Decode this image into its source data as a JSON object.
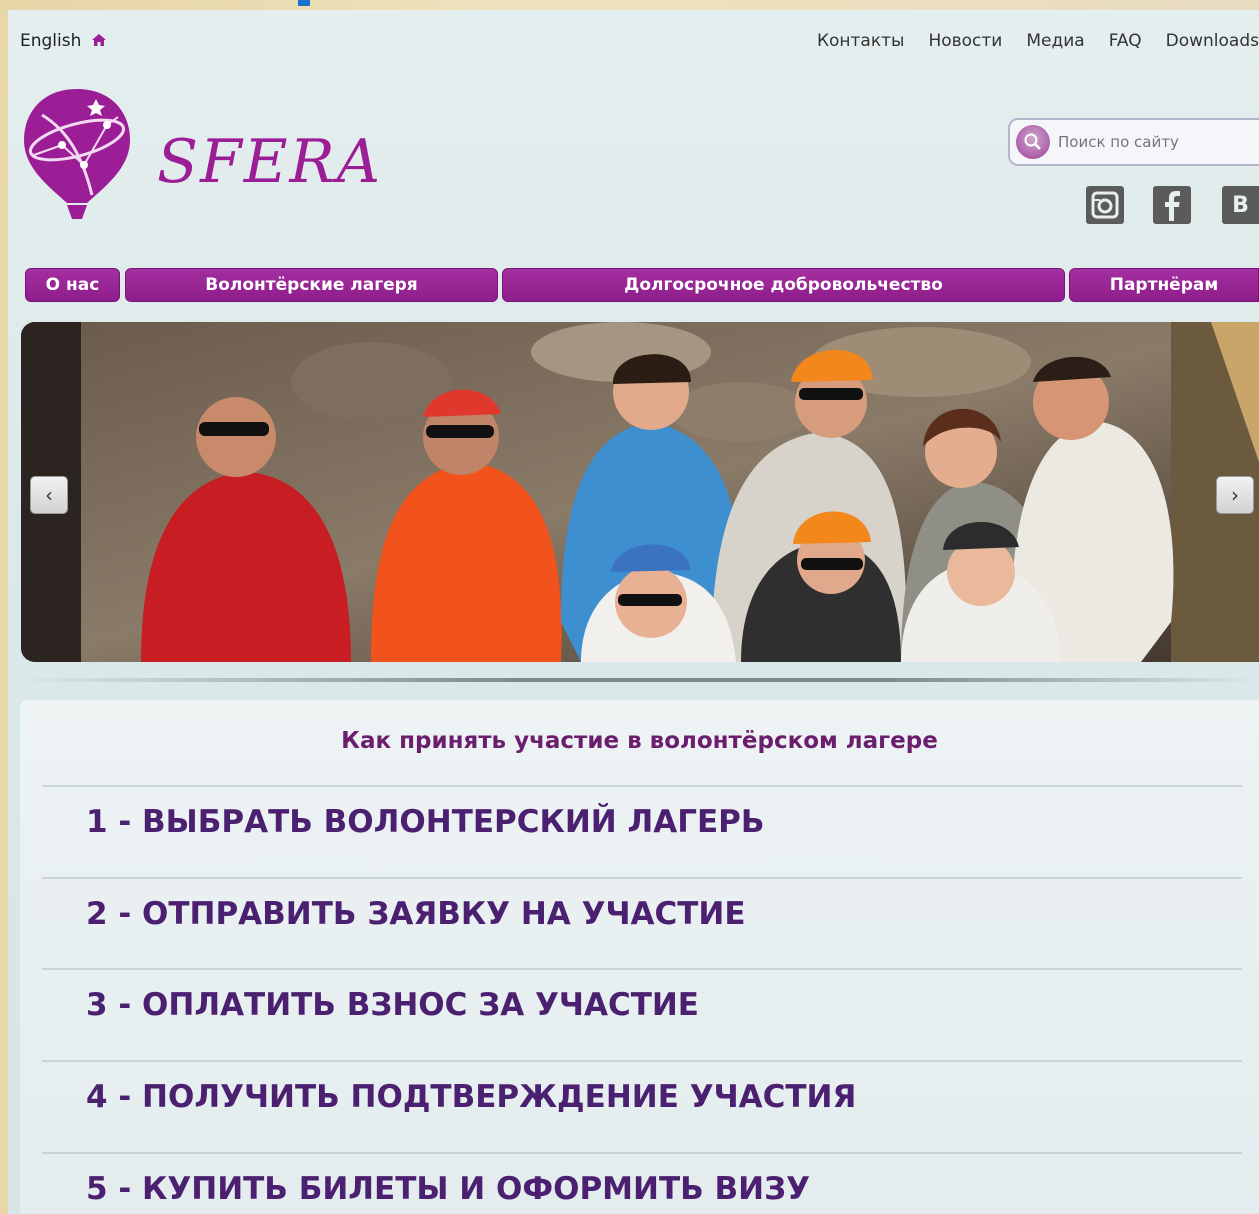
{
  "top": {
    "language": "English",
    "nav": [
      "Контакты",
      "Новости",
      "Медиа",
      "FAQ",
      "Downloads"
    ]
  },
  "logo": {
    "text": "SFERA"
  },
  "search": {
    "placeholder": "Поиск по сайту"
  },
  "social": [
    "instagram-icon",
    "facebook-icon",
    "vk-icon"
  ],
  "mainnav": [
    "О нас",
    "Волонтёрские лагеря",
    "Долгосрочное добровольчество",
    "Партнёрам"
  ],
  "slider": {
    "prev": "‹",
    "next": "›"
  },
  "content": {
    "title": "Как принять участие в волонтёрском лагере",
    "steps": [
      "1 - ВЫБРАТЬ ВОЛОНТЕРСКИЙ ЛАГЕРЬ",
      "2 - ОТПРАВИТЬ ЗАЯВКУ НА УЧАСТИЕ",
      "3 - ОПЛАТИТЬ ВЗНОС ЗА УЧАСТИЕ",
      "4 - ПОЛУЧИТЬ ПОДТВЕРЖДЕНИЕ УЧАСТИЯ",
      "5 - КУПИТЬ БИЛЕТЫ И ОФОРМИТЬ ВИЗУ"
    ]
  },
  "colors": {
    "brand": "#9b1e97",
    "step_text": "#4b2070",
    "title_text": "#6b1e6e"
  }
}
